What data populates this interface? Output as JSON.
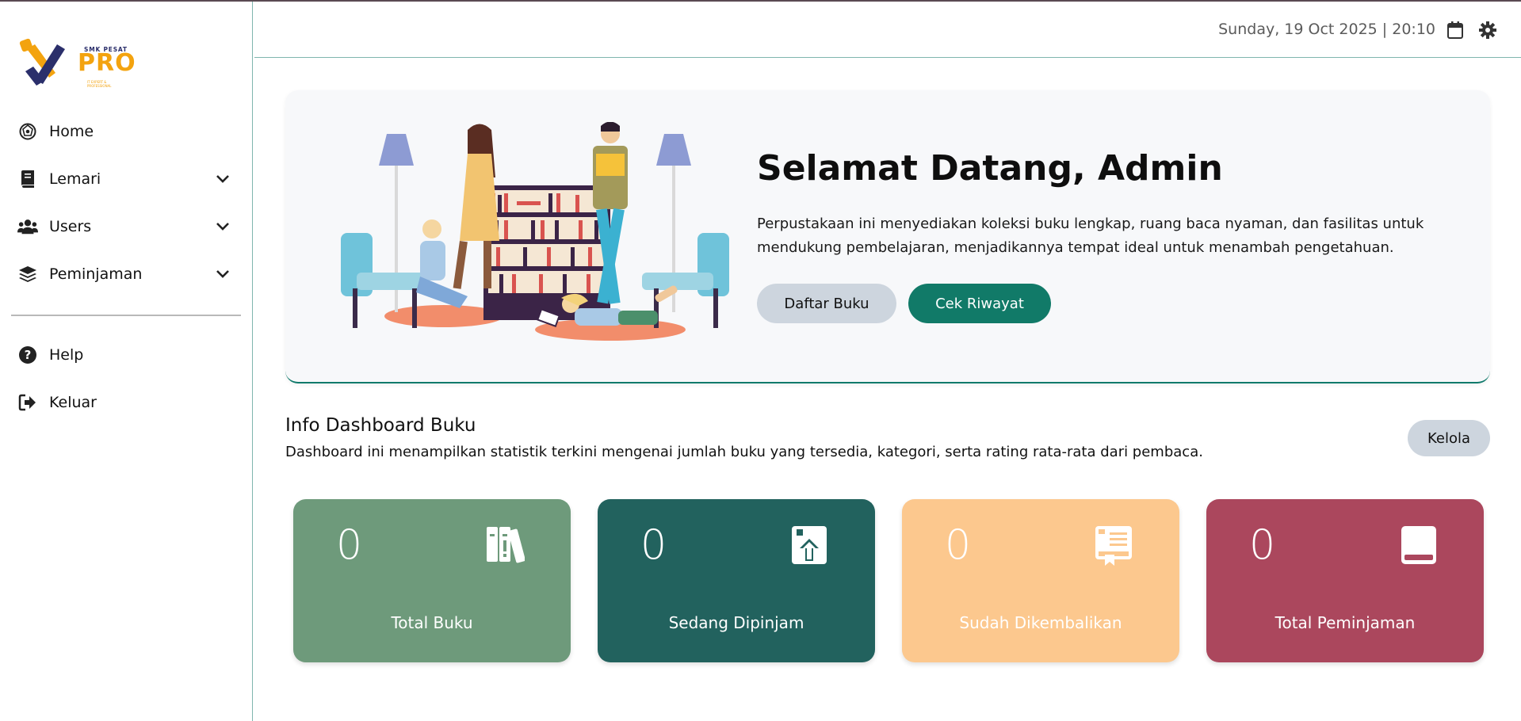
{
  "brand": {
    "school": "SMK PESAT",
    "name": "PRO",
    "tagline": "IT EXPERT & PROFESSIONAL"
  },
  "sidebar": {
    "items": [
      {
        "label": "Home",
        "icon": "home-icon"
      },
      {
        "label": "Lemari",
        "icon": "book-icon",
        "has_submenu": true
      },
      {
        "label": "Users",
        "icon": "users-icon",
        "has_submenu": true
      },
      {
        "label": "Peminjaman",
        "icon": "layers-icon",
        "has_submenu": true
      }
    ],
    "bottom_items": [
      {
        "label": "Help",
        "icon": "help-icon"
      },
      {
        "label": "Keluar",
        "icon": "logout-icon"
      }
    ]
  },
  "header": {
    "datetime": "Sunday, 19 Oct 2025 | 20:10"
  },
  "hero": {
    "title": "Selamat Datang, Admin",
    "description": "Perpustakaan ini menyediakan koleksi buku lengkap, ruang baca nyaman, dan fasilitas untuk mendukung pembelajaran, menjadikannya tempat ideal untuk menambah pengetahuan.",
    "primary_button": "Daftar Buku",
    "secondary_button": "Cek Riwayat"
  },
  "info": {
    "title": "Info Dashboard Buku",
    "description": "Dashboard ini menampilkan statistik terkini mengenai jumlah buku yang tersedia, kategori, serta rating rata-rata dari pembaca.",
    "manage_button": "Kelola"
  },
  "cards": [
    {
      "count": "0",
      "label": "Total Buku",
      "color": "#6e9a7b",
      "icon": "books-icon"
    },
    {
      "count": "0",
      "label": "Sedang Dipinjam",
      "color": "#22625e",
      "icon": "book-upload-icon"
    },
    {
      "count": "0",
      "label": "Sudah Dikembalikan",
      "color": "#fcc88e",
      "icon": "book-bookmark-icon"
    },
    {
      "count": "0",
      "label": "Total Peminjaman",
      "color": "#ab475d",
      "icon": "book-closed-icon"
    }
  ],
  "colors": {
    "accent": "#117a68",
    "border": "#7fb6ae",
    "neutral_button": "#cdd5de"
  }
}
